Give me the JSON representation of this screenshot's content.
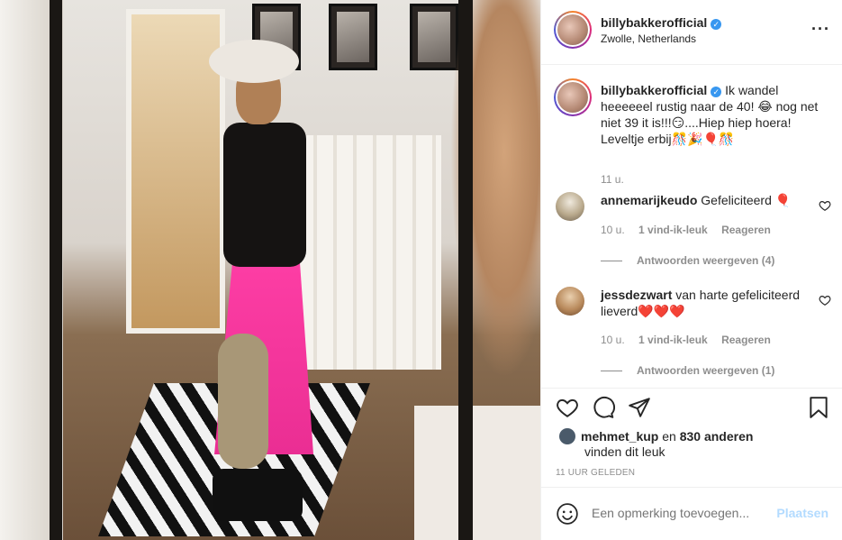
{
  "post": {
    "username": "billybakkerofficial",
    "location": "Zwolle, Netherlands",
    "more_icon": "more-horizontal-icon"
  },
  "caption": {
    "username": "billybakkerofficial",
    "text": "Ik wandel heeeeeel rustig naar de 40! 😂 nog net niet 39 it is!!!😏....Hiep hiep hoera! Leveltje erbij🎊🎉🎈🎊",
    "time": "11 u."
  },
  "comments": [
    {
      "username": "annemarijkeudo",
      "text": "Gefeliciteerd 🎈",
      "time": "10 u.",
      "likes": "1 vind-ik-leuk",
      "reply": "Reageren",
      "view_replies": "Antwoorden weergeven (4)"
    },
    {
      "username": "jessdezwart",
      "text": "van harte gefeliciteerd lieverd❤️❤️❤️",
      "time": "10 u.",
      "likes": "1 vind-ik-leuk",
      "reply": "Reageren",
      "view_replies": "Antwoorden weergeven (1)"
    }
  ],
  "likes": {
    "user": "mehmet_kup",
    "connector": "en",
    "others": "830 anderen",
    "suffix": "vinden dit leuk"
  },
  "timestamp": "11 UUR GELEDEN",
  "add_comment": {
    "placeholder": "Een opmerking toevoegen...",
    "post_label": "Plaatsen"
  },
  "colors": {
    "verified": "#3897f0",
    "post_button_disabled": "#b3dbff",
    "secondary_text": "#8e8e8e"
  }
}
